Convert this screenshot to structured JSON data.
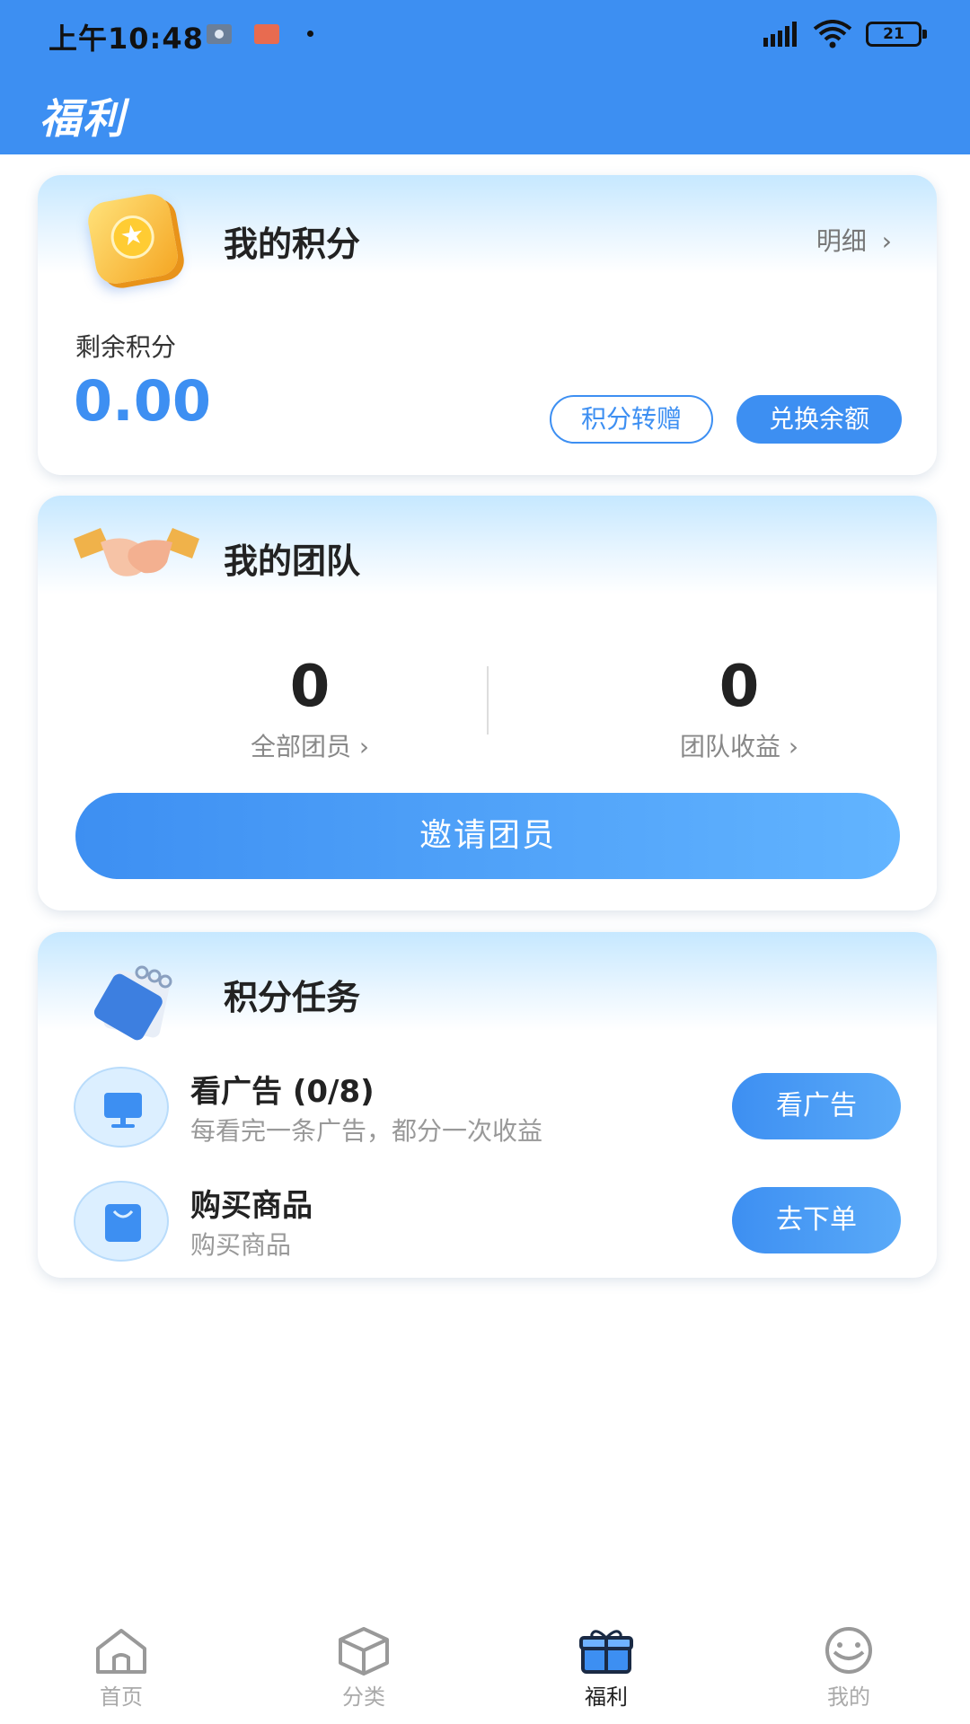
{
  "status_bar": {
    "time": "上午10:48",
    "battery": "21"
  },
  "header": {
    "title": "福利"
  },
  "points": {
    "title": "我的积分",
    "detail_label": "明细",
    "remaining_label": "剩余积分",
    "remaining_value": "0.00",
    "transfer_button": "积分转赠",
    "exchange_button": "兑换余额"
  },
  "team": {
    "title": "我的团队",
    "members_value": "0",
    "members_label": "全部团员",
    "earnings_value": "0",
    "earnings_label": "团队收益",
    "invite_button": "邀请团员"
  },
  "tasks": {
    "title": "积分任务",
    "items": [
      {
        "name": "看广告 (0/8)",
        "desc": "每看完一条广告，都分一次收益",
        "button": "看广告",
        "icon": "monitor-icon"
      },
      {
        "name": "购买商品",
        "desc": "购买商品",
        "button": "去下单",
        "icon": "shopping-bag-icon"
      }
    ]
  },
  "nav": {
    "items": [
      {
        "label": "首页",
        "icon": "home-icon"
      },
      {
        "label": "分类",
        "icon": "box-icon"
      },
      {
        "label": "福利",
        "icon": "gift-icon",
        "active": true
      },
      {
        "label": "我的",
        "icon": "smile-icon"
      }
    ]
  },
  "colors": {
    "primary": "#3d8ff2",
    "header_bg": "#3d8ff2"
  }
}
